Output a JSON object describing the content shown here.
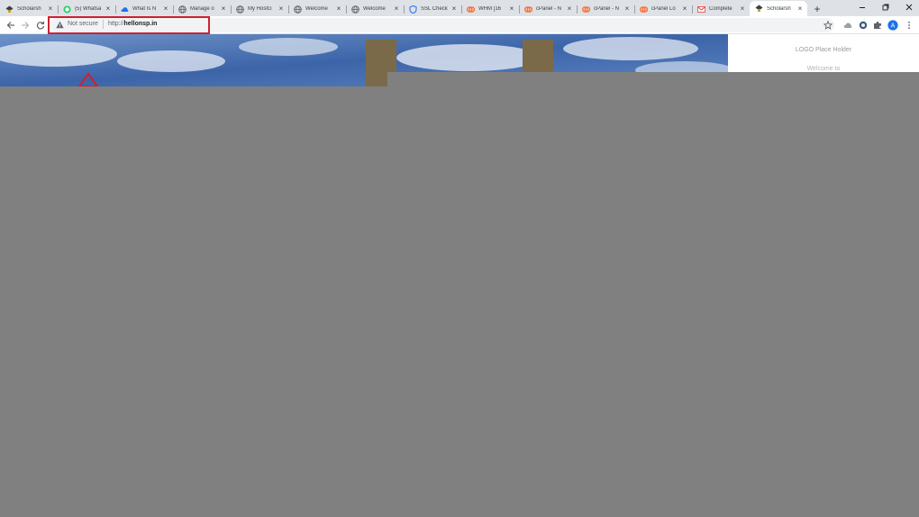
{
  "browser": {
    "tabs": [
      {
        "title": "Scholarsh",
        "icon": "scholar-favicon",
        "active": false
      },
      {
        "title": "(5) Whatsa",
        "icon": "whatsapp-favicon",
        "active": false
      },
      {
        "title": "What Is N",
        "icon": "cloud-favicon",
        "active": false
      },
      {
        "title": "Manage o",
        "icon": "globe-favicon",
        "active": false
      },
      {
        "title": "My HostG",
        "icon": "globe-favicon",
        "active": false
      },
      {
        "title": "Welcome",
        "icon": "globe-favicon",
        "active": false
      },
      {
        "title": "Welcome",
        "icon": "globe-favicon",
        "active": false
      },
      {
        "title": "SSL Check",
        "icon": "shield-favicon",
        "active": false
      },
      {
        "title": "WHM [16",
        "icon": "cpanel-favicon",
        "active": false
      },
      {
        "title": "cPanel - N",
        "icon": "cpanel-favicon",
        "active": false
      },
      {
        "title": "cPanel - N",
        "icon": "cpanel-favicon",
        "active": false
      },
      {
        "title": "cPanel Lo",
        "icon": "cpanel-favicon",
        "active": false
      },
      {
        "title": "Complete",
        "icon": "gmail-favicon",
        "active": false
      },
      {
        "title": "Scholarsh",
        "icon": "scholar-favicon",
        "active": true
      }
    ],
    "address_bar": {
      "security_label": "Not secure",
      "scheme": "http://",
      "host": "hellonsp.in"
    },
    "colors": {
      "highlight": "#d0202e",
      "tab_strip": "#dee1e6",
      "overlay": "#808080"
    }
  },
  "page": {
    "logo_placeholder": "LOGO Place Holder",
    "welcome": "Welcome to"
  }
}
